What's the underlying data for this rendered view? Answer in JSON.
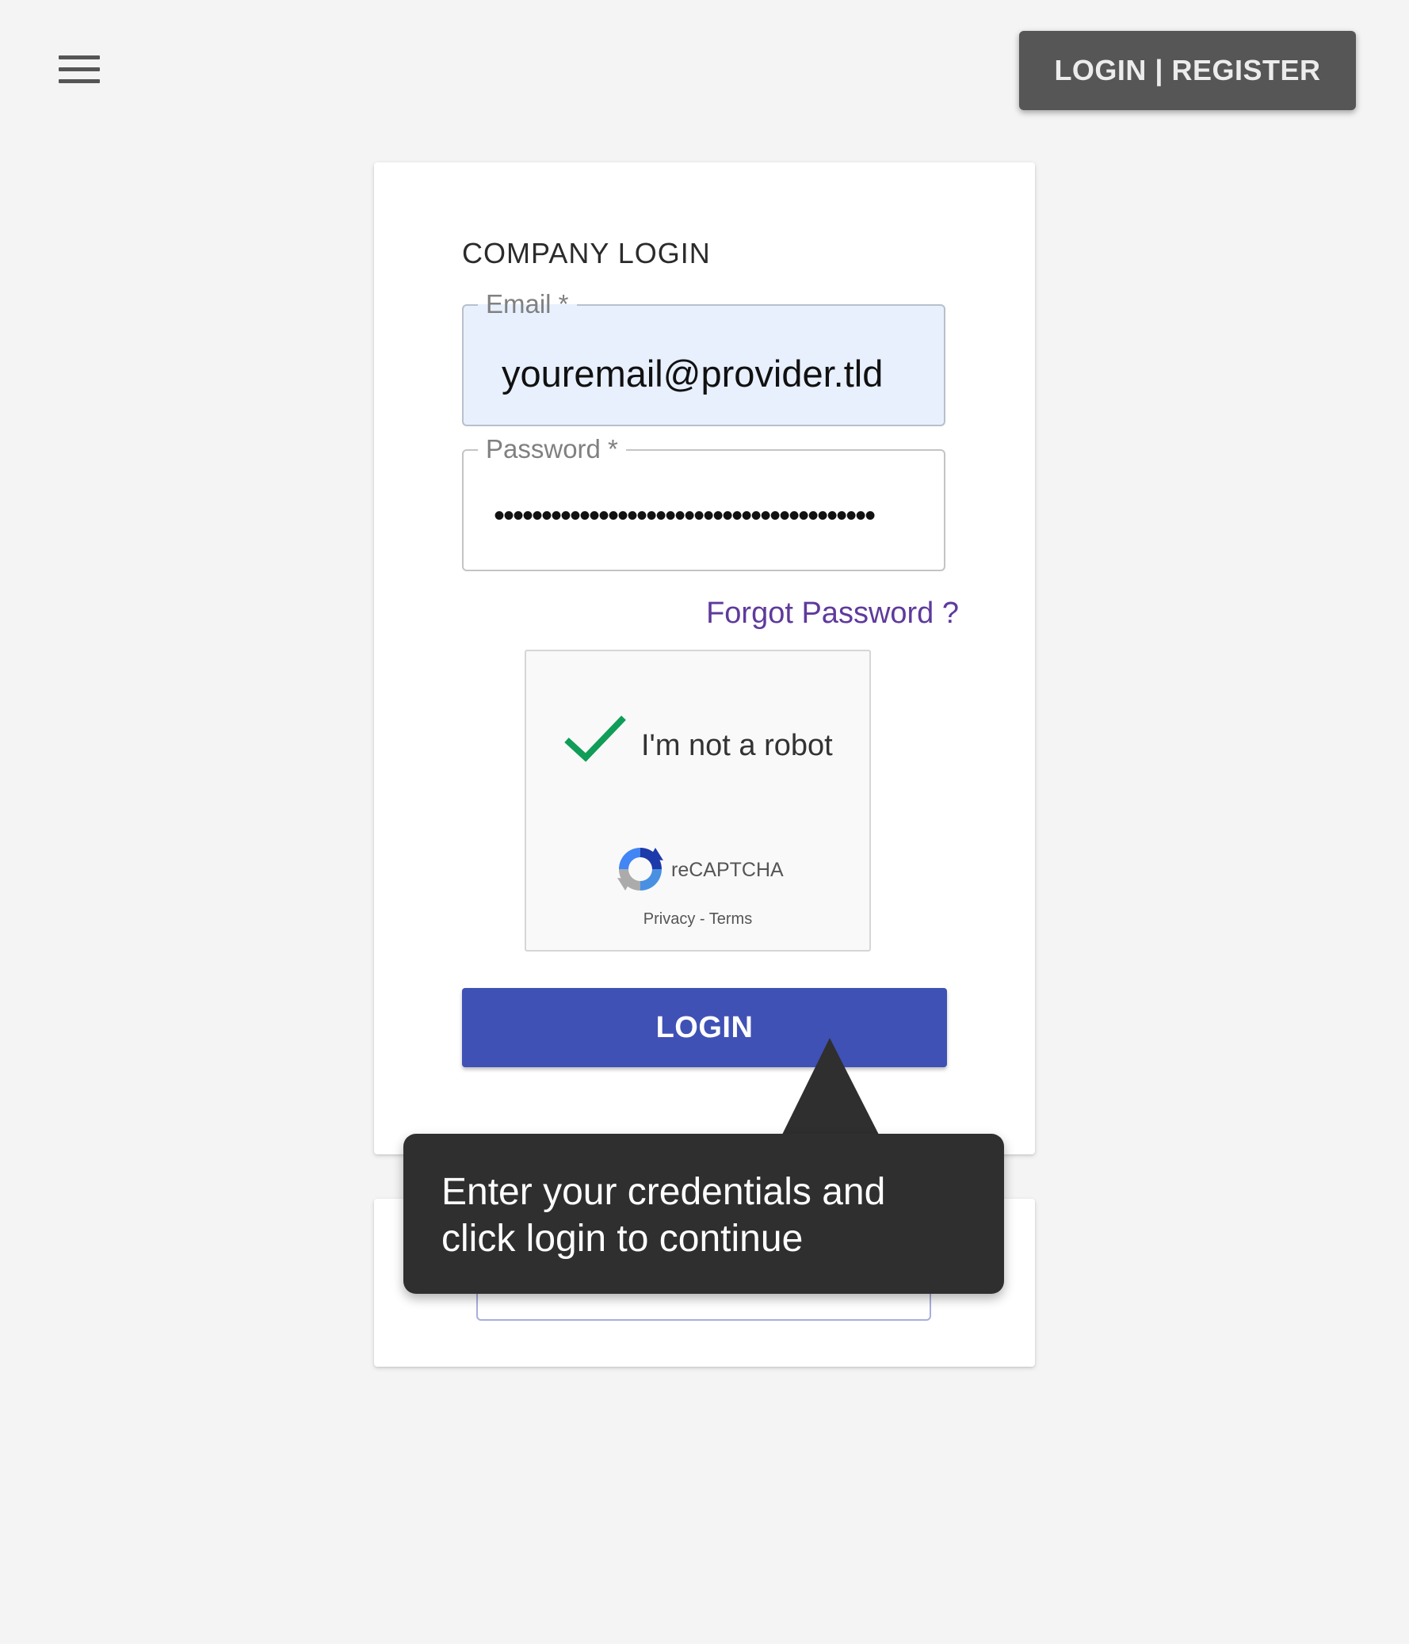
{
  "header": {
    "menu_icon": "hamburger-menu-icon",
    "login_register_label": "LOGIN | REGISTER"
  },
  "login_card": {
    "title": "COMPANY LOGIN",
    "email": {
      "label": "Email *",
      "value": "youremail@provider.tld"
    },
    "password": {
      "label": "Password *",
      "masked_value": "••••••••••••••••••••••••••••••••••••••••"
    },
    "forgot_password_label": "Forgot Password ?",
    "recaptcha": {
      "checkbox_label": "I'm not a robot",
      "checked": true,
      "brand": "reCAPTCHA",
      "privacy_label": "Privacy",
      "separator": " - ",
      "terms_label": "Terms"
    },
    "login_button_label": "LOGIN"
  },
  "tooltip": {
    "line1": "Enter your credentials and",
    "line2": "click login to continue"
  },
  "colors": {
    "primary": "#3f51b5",
    "dark_button": "#565656",
    "tooltip_bg": "#2f2f2f",
    "link": "#5e3a9c",
    "check_green": "#0f9d58",
    "autofill_bg": "#e8f0fe"
  }
}
